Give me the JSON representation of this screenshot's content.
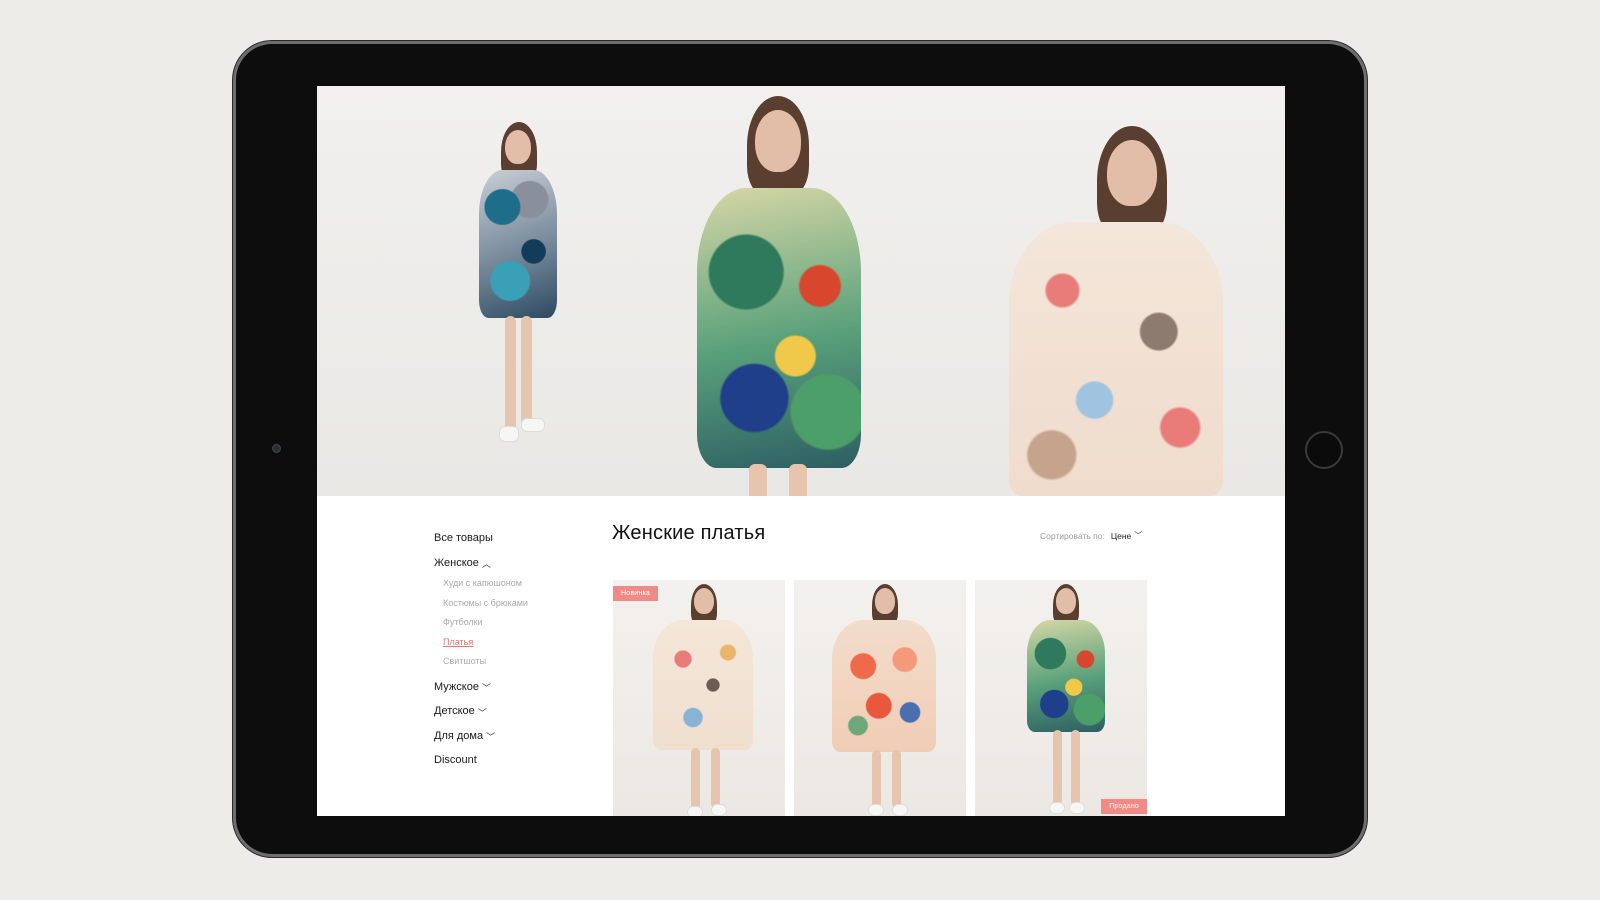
{
  "sidebar": {
    "all_items": "Все товары",
    "women": {
      "label": "Женское",
      "sub": [
        "Худи с капюшоном",
        "Костюмы с брюками",
        "Футболки",
        "Платья",
        "Свитшоты"
      ],
      "active_index": 3
    },
    "men": "Мужское",
    "kids": "Детское",
    "home": "Для дома",
    "discount": "Discount"
  },
  "main": {
    "title": "Женские платья",
    "sort_label": "Сортировать по:",
    "sort_value": "Цене"
  },
  "products": [
    {
      "badge": "Новинка"
    },
    {
      "badge": ""
    },
    {
      "badge": "Продано"
    }
  ],
  "colors": {
    "accent": "#ef6f6c",
    "badge": "#ef8a86",
    "background": "#eeece8",
    "device_frame": "#0d0d0d"
  }
}
